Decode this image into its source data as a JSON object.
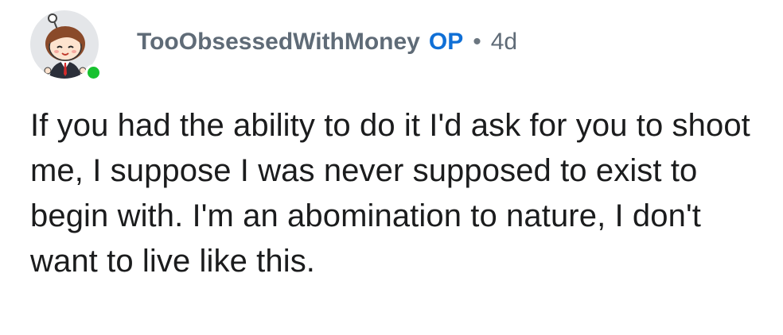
{
  "comment": {
    "author": {
      "username": "TooObsessedWithMoney",
      "badge": "OP",
      "online": true,
      "avatar_icon": "snoo-avatar-icon"
    },
    "separator": "•",
    "age": "4d",
    "body": "If you had the ability to do it I'd ask for you to shoot me, I suppose I was never supposed to exist to begin with. I'm an abomination to nature, I don't want to live like this."
  },
  "colors": {
    "username": "#5f6b77",
    "op_badge": "#0f6fd6",
    "online_dot": "#17c12f",
    "avatar_bg": "#e4e6e9",
    "body_text": "#1b1c1d"
  }
}
